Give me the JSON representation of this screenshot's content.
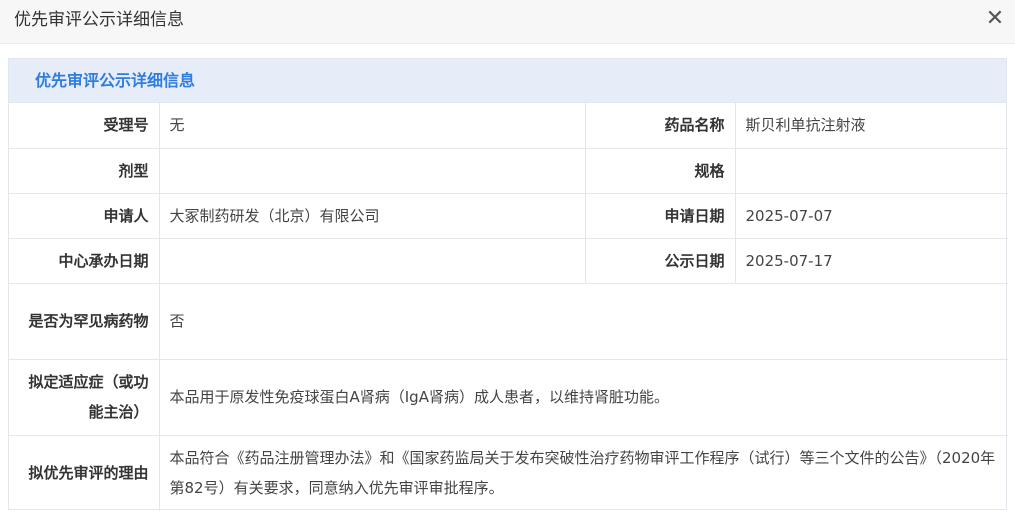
{
  "dialog": {
    "title": "优先审评公示详细信息",
    "close_glyph": "✕"
  },
  "panel": {
    "heading": "优先审评公示详细信息"
  },
  "fields": {
    "acceptance_no": {
      "label": "受理号",
      "value": "无"
    },
    "drug_name": {
      "label": "药品名称",
      "value": "斯贝利单抗注射液"
    },
    "dosage_form": {
      "label": "剂型",
      "value": ""
    },
    "specification": {
      "label": "规格",
      "value": ""
    },
    "applicant": {
      "label": "申请人",
      "value": "大冢制药研发（北京）有限公司"
    },
    "apply_date": {
      "label": "申请日期",
      "value": "2025-07-07"
    },
    "center_date": {
      "label": "中心承办日期",
      "value": ""
    },
    "publish_date": {
      "label": "公示日期",
      "value": "2025-07-17"
    },
    "rare_disease": {
      "label": "是否为罕见病药物",
      "value": "否"
    },
    "indication": {
      "label": "拟定适应症（或功能主治）",
      "value": "本品用于原发性免疫球蛋白A肾病（IgA肾病）成人患者，以维持肾脏功能。"
    },
    "reason": {
      "label": "拟优先审评的理由",
      "value": "本品符合《药品注册管理办法》和《国家药监局关于发布突破性治疗药物审评工作程序（试行）等三个文件的公告》（2020年第82号）有关要求，同意纳入优先审评审批程序。"
    }
  }
}
